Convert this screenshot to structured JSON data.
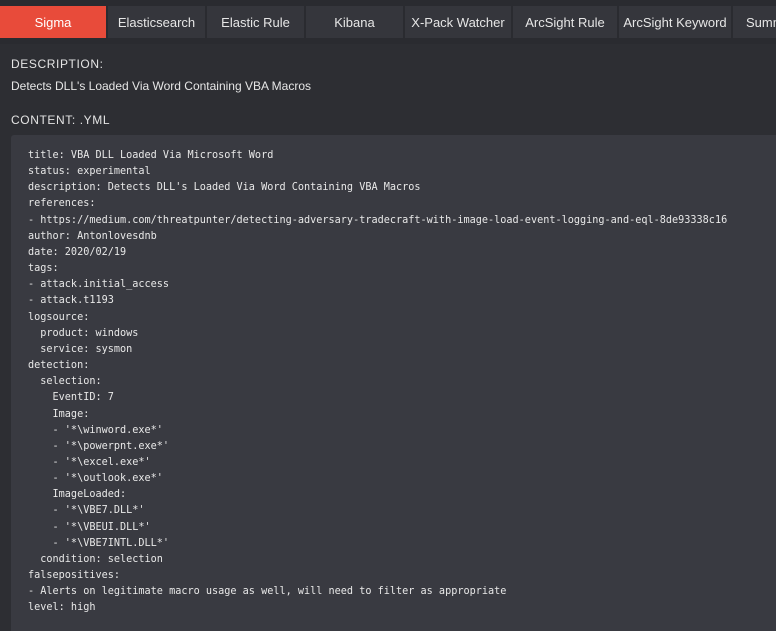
{
  "tabs": [
    {
      "label": "Sigma",
      "active": true
    },
    {
      "label": "Elasticsearch",
      "active": false
    },
    {
      "label": "Elastic Rule",
      "active": false
    },
    {
      "label": "Kibana",
      "active": false
    },
    {
      "label": "X-Pack Watcher",
      "active": false
    },
    {
      "label": "ArcSight Rule",
      "active": false
    },
    {
      "label": "ArcSight Keyword",
      "active": false
    },
    {
      "label": "Summ",
      "active": false
    }
  ],
  "description": {
    "heading": "DESCRIPTION:",
    "text": "Detects DLL's Loaded Via Word Containing VBA Macros"
  },
  "content": {
    "heading": "CONTENT: .YML",
    "lines": [
      "title: VBA DLL Loaded Via Microsoft Word",
      "status: experimental",
      "description: Detects DLL's Loaded Via Word Containing VBA Macros",
      "references:",
      "- https://medium.com/threatpunter/detecting-adversary-tradecraft-with-image-load-event-logging-and-eql-8de93338c16",
      "author: Antonlovesdnb",
      "date: 2020/02/19",
      "tags:",
      "- attack.initial_access",
      "- attack.t1193",
      "logsource:",
      "  product: windows",
      "  service: sysmon",
      "detection:",
      "  selection:",
      "    EventID: 7",
      "    Image:",
      "    - '*\\winword.exe*'",
      "    - '*\\powerpnt.exe*'",
      "    - '*\\excel.exe*'",
      "    - '*\\outlook.exe*'",
      "    ImageLoaded:",
      "    - '*\\VBE7.DLL*'",
      "    - '*\\VBEUI.DLL*'",
      "    - '*\\VBE7INTL.DLL*'",
      "  condition: selection",
      "falsepositives:",
      "- Alerts on legitimate macro usage as well, will need to filter as appropriate",
      "level: high"
    ]
  },
  "colors": {
    "active_tab": "#e84b3a",
    "background": "#2d2e33",
    "code_background": "#393a41"
  }
}
